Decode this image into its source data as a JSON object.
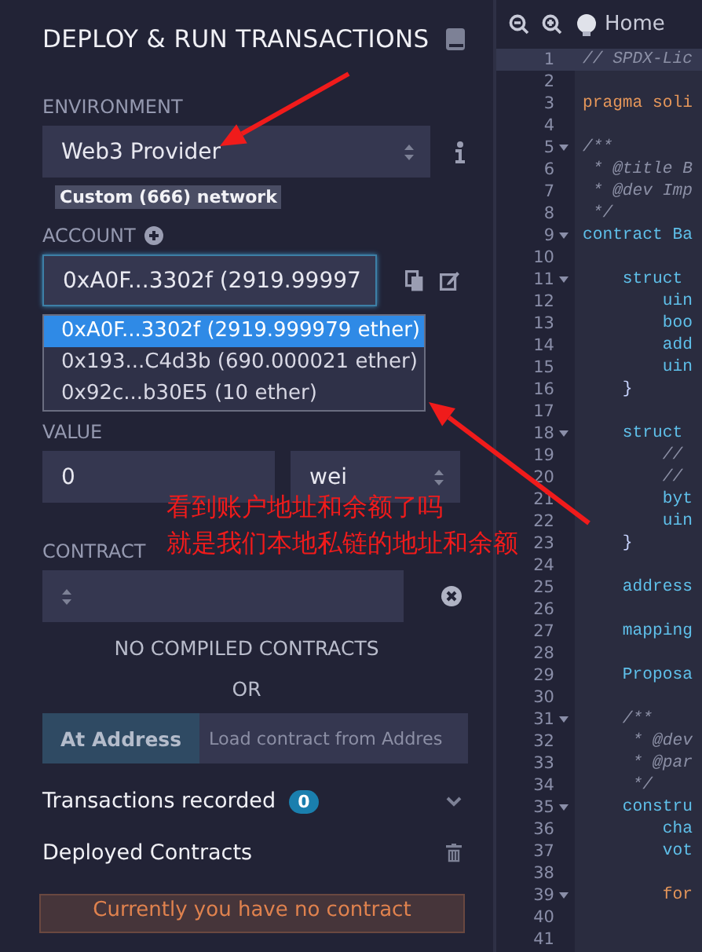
{
  "panel": {
    "title": "DEPLOY & RUN TRANSACTIONS",
    "environment": {
      "label": "ENVIRONMENT",
      "value": "Web3 Provider",
      "network_badge": "Custom (666) network"
    },
    "account": {
      "label": "ACCOUNT",
      "value": "0xA0F...3302f (2919.99997",
      "options": [
        {
          "label": "0xA0F...3302f (2919.999979 ether)",
          "selected": true
        },
        {
          "label": "0x193...C4d3b (690.000021 ether)",
          "selected": false
        },
        {
          "label": "0x92c...b30E5 (10 ether)",
          "selected": false
        }
      ]
    },
    "value": {
      "label": "VALUE",
      "amount": "0",
      "unit": "wei"
    },
    "contract": {
      "label": "CONTRACT",
      "empty_message": "NO COMPILED CONTRACTS",
      "or_label": "OR",
      "at_address_button": "At Address",
      "address_field": {
        "placeholder": "Load contract from Addres"
      }
    },
    "transactions": {
      "label": "Transactions recorded",
      "count": "0"
    },
    "deployed": {
      "label": "Deployed Contracts",
      "notice": "Currently you have no contract"
    }
  },
  "editor": {
    "tab": "Home",
    "lines": [
      {
        "number": "1",
        "text": "// SPDX-Lic",
        "kind": "comment",
        "fold": false,
        "active": true
      },
      {
        "number": "2",
        "kind": "plain",
        "fold": false,
        "active": false
      },
      {
        "number": "3",
        "text": "pragma soli",
        "kind": "keyword",
        "fold": false,
        "active": false
      },
      {
        "number": "4",
        "kind": "plain",
        "fold": false,
        "active": false
      },
      {
        "number": "5",
        "text": "/**",
        "kind": "comment",
        "fold": true,
        "active": false
      },
      {
        "number": "6",
        "text": " * @title B",
        "kind": "comment",
        "fold": false,
        "active": false
      },
      {
        "number": "7",
        "text": " * @dev Imp",
        "kind": "comment",
        "fold": false,
        "active": false
      },
      {
        "number": "8",
        "text": " */",
        "kind": "comment",
        "fold": false,
        "active": false
      },
      {
        "number": "9",
        "text": "contract Ba",
        "kind": "type",
        "fold": true,
        "active": false
      },
      {
        "number": "10",
        "kind": "plain",
        "fold": false,
        "active": false
      },
      {
        "number": "11",
        "text": "    struct",
        "kind": "type",
        "fold": true,
        "active": false
      },
      {
        "number": "12",
        "text": "        uin",
        "kind": "type",
        "fold": false,
        "active": false
      },
      {
        "number": "13",
        "text": "        boo",
        "kind": "type",
        "fold": false,
        "active": false
      },
      {
        "number": "14",
        "text": "        add",
        "kind": "type",
        "fold": false,
        "active": false
      },
      {
        "number": "15",
        "text": "        uin",
        "kind": "type",
        "fold": false,
        "active": false
      },
      {
        "number": "16",
        "text": "    }",
        "kind": "plain",
        "fold": false,
        "active": false
      },
      {
        "number": "17",
        "kind": "plain",
        "fold": false,
        "active": false
      },
      {
        "number": "18",
        "text": "    struct",
        "kind": "type",
        "fold": true,
        "active": false
      },
      {
        "number": "19",
        "text": "        //",
        "kind": "comment",
        "fold": false,
        "active": false
      },
      {
        "number": "20",
        "text": "        //",
        "kind": "comment",
        "fold": false,
        "active": false
      },
      {
        "number": "21",
        "text": "        byt",
        "kind": "type",
        "fold": false,
        "active": false
      },
      {
        "number": "22",
        "text": "        uin",
        "kind": "type",
        "fold": false,
        "active": false
      },
      {
        "number": "23",
        "text": "    }",
        "kind": "plain",
        "fold": false,
        "active": false
      },
      {
        "number": "24",
        "kind": "plain",
        "fold": false,
        "active": false
      },
      {
        "number": "25",
        "text": "    address",
        "kind": "type",
        "fold": false,
        "active": false
      },
      {
        "number": "26",
        "kind": "plain",
        "fold": false,
        "active": false
      },
      {
        "number": "27",
        "text": "    mapping",
        "kind": "type",
        "fold": false,
        "active": false
      },
      {
        "number": "28",
        "kind": "plain",
        "fold": false,
        "active": false
      },
      {
        "number": "29",
        "text": "    Proposa",
        "kind": "type",
        "fold": false,
        "active": false
      },
      {
        "number": "30",
        "kind": "plain",
        "fold": false,
        "active": false
      },
      {
        "number": "31",
        "text": "    /**",
        "kind": "comment",
        "fold": true,
        "active": false
      },
      {
        "number": "32",
        "text": "     * @dev",
        "kind": "comment",
        "fold": false,
        "active": false
      },
      {
        "number": "33",
        "text": "     * @par",
        "kind": "comment",
        "fold": false,
        "active": false
      },
      {
        "number": "34",
        "text": "     */",
        "kind": "comment",
        "fold": false,
        "active": false
      },
      {
        "number": "35",
        "text": "    constru",
        "kind": "type",
        "fold": true,
        "active": false
      },
      {
        "number": "36",
        "text": "        cha",
        "kind": "type",
        "fold": false,
        "active": false
      },
      {
        "number": "37",
        "text": "        vot",
        "kind": "type",
        "fold": false,
        "active": false
      },
      {
        "number": "38",
        "kind": "plain",
        "fold": false,
        "active": false
      },
      {
        "number": "39",
        "text": "        for",
        "kind": "keyword",
        "fold": true,
        "active": false
      },
      {
        "number": "40",
        "kind": "plain",
        "fold": false,
        "active": false
      },
      {
        "number": "41",
        "kind": "plain",
        "fold": false,
        "active": false
      }
    ]
  },
  "annotation": {
    "lines": [
      "看到账户地址和余额了吗",
      "就是我们本地私链的地址和余额"
    ]
  }
}
